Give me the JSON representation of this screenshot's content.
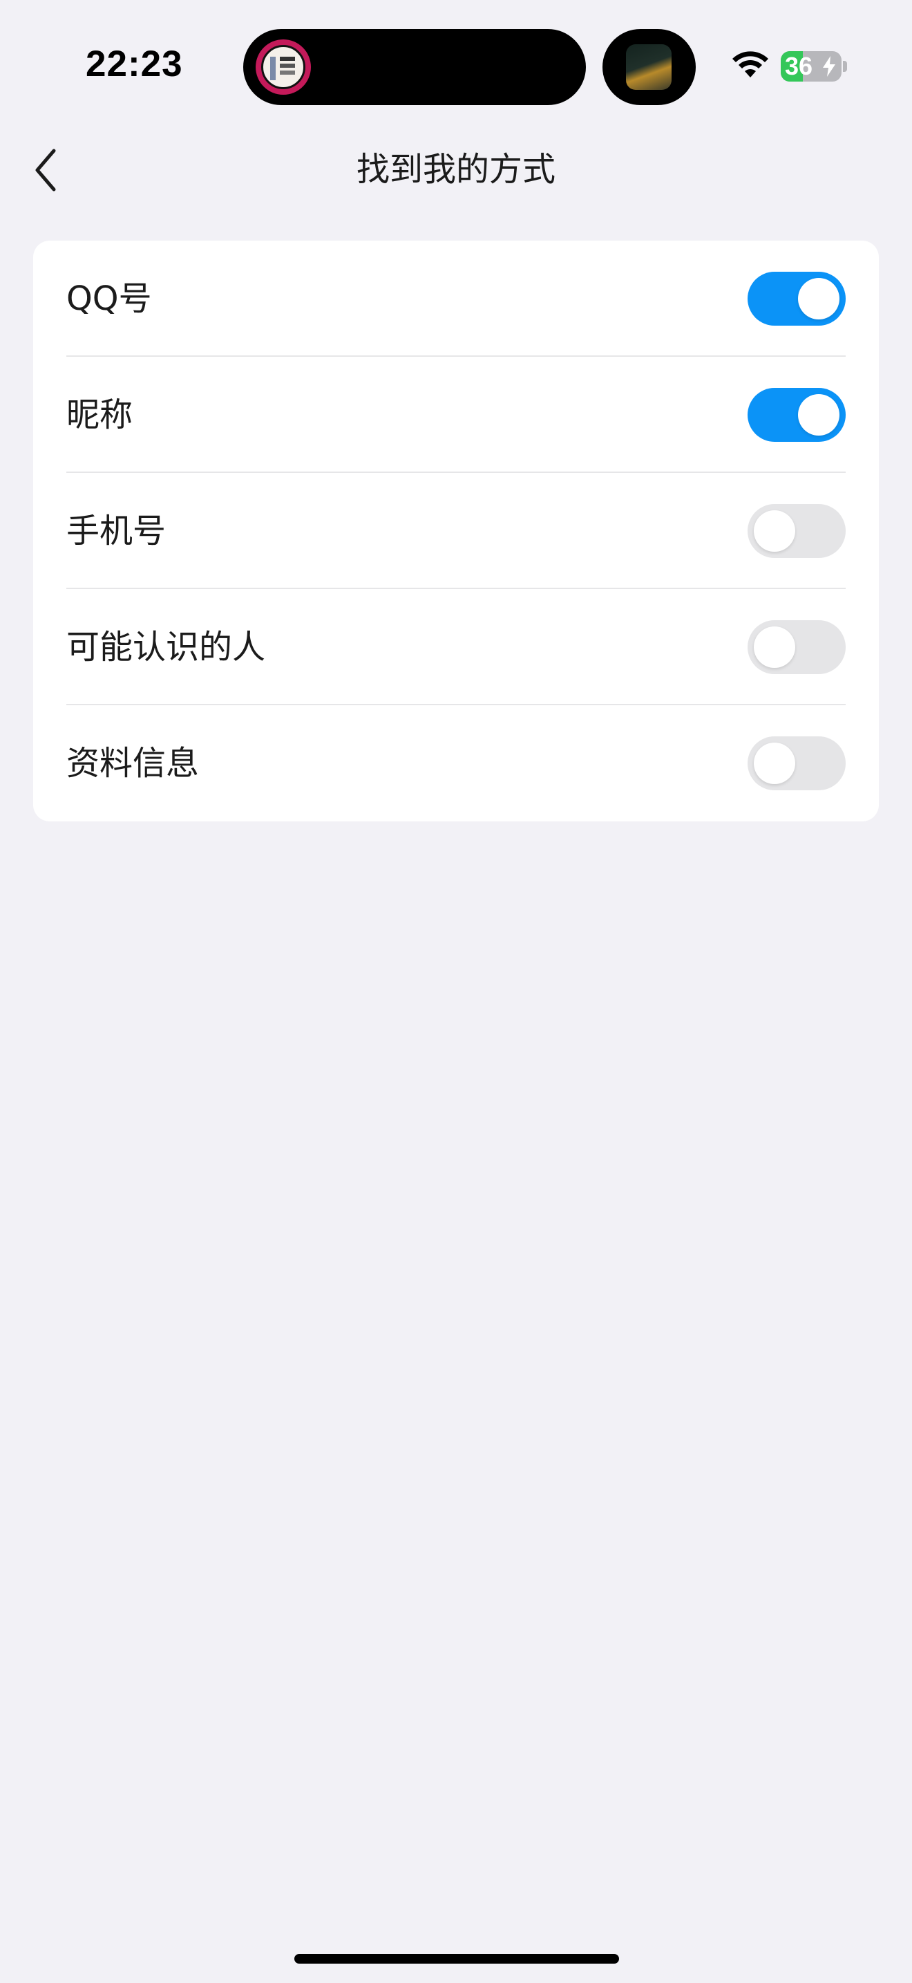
{
  "status_bar": {
    "time": "22:23",
    "battery_level": "36",
    "battery_fraction": 0.36,
    "battery_charging": true,
    "wifi_icon": "wifi-icon",
    "island_left_icon": "now-playing-album-art",
    "island_right_icon": "live-activity-thumbnail"
  },
  "nav": {
    "title": "找到我的方式",
    "back_icon": "chevron-left-icon"
  },
  "settings": [
    {
      "label": "QQ号",
      "enabled": true
    },
    {
      "label": "昵称",
      "enabled": true
    },
    {
      "label": "手机号",
      "enabled": false
    },
    {
      "label": "可能认识的人",
      "enabled": false
    },
    {
      "label": "资料信息",
      "enabled": false
    }
  ],
  "colors": {
    "background": "#f2f1f6",
    "toggle_on": "#0b93f7",
    "toggle_off": "#e5e5e7",
    "battery_green": "#34c759"
  }
}
